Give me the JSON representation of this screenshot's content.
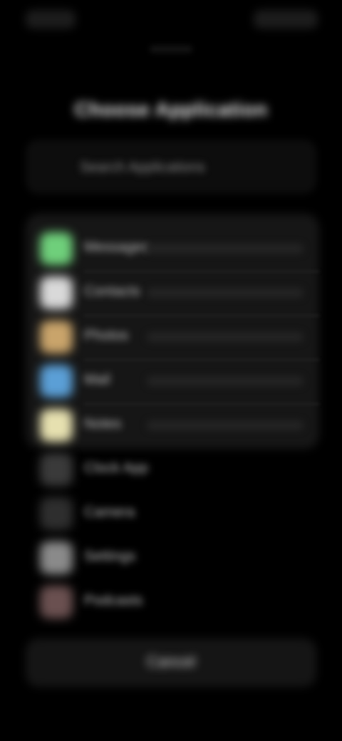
{
  "status_bar": {
    "time": "",
    "icons": ""
  },
  "sheet": {
    "title": "Choose Application",
    "search": {
      "placeholder": "Search Applications"
    },
    "apps": [
      {
        "label": "Messages",
        "icon": "messages-icon",
        "color": "#6fcf7b"
      },
      {
        "label": "Contacts",
        "icon": "contacts-icon",
        "color": "#d9d9d9"
      },
      {
        "label": "Photos",
        "icon": "photos-icon",
        "color": "#c9a46b"
      },
      {
        "label": "Mail",
        "icon": "mail-icon",
        "color": "#5b9fd6"
      },
      {
        "label": "Notes",
        "icon": "notes-icon",
        "color": "#e6e0b0"
      },
      {
        "label": "Clock App",
        "icon": "clock-icon",
        "color": "#3a3a3a"
      },
      {
        "label": "Camera",
        "icon": "camera-icon",
        "color": "#2e2e2e"
      },
      {
        "label": "Settings",
        "icon": "settings-icon",
        "color": "#8a8a8a"
      },
      {
        "label": "Podcasts",
        "icon": "podcasts-icon",
        "color": "#6a5050"
      }
    ],
    "cancel_label": "Cancel"
  }
}
